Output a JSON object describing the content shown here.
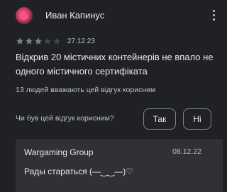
{
  "review": {
    "author": "Иван Капинус",
    "rating": 3,
    "max_rating": 5,
    "date": "27.12.23",
    "text": "Відкрив 20 містичних контейнерів не впало не одного містичного сертифіката",
    "helpful_count": "13 людей вважають цей відгук корисним"
  },
  "helpful": {
    "question": "Чи був цей відгук корисним?",
    "yes_label": "Так",
    "no_label": "Ні"
  },
  "reply": {
    "author": "Wargaming Group",
    "date": "08.12.22",
    "text": "Рады стараться (—‿‿—)♡"
  },
  "colors": {
    "star_filled": "#7e8388",
    "star_empty": "#44474c"
  }
}
